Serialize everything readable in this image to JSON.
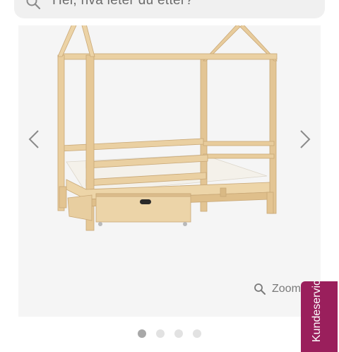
{
  "search": {
    "placeholder": "Hei, hva leter du etter?"
  },
  "gallery": {
    "image_alt_icon": "bed-product-image",
    "zoom_label": "Zoom",
    "total_images": 4,
    "active_index": 0
  },
  "service_tab": {
    "label": "Kundeservice"
  },
  "colors": {
    "accent": "#9a1f5c",
    "wood": "#e6c99a"
  }
}
